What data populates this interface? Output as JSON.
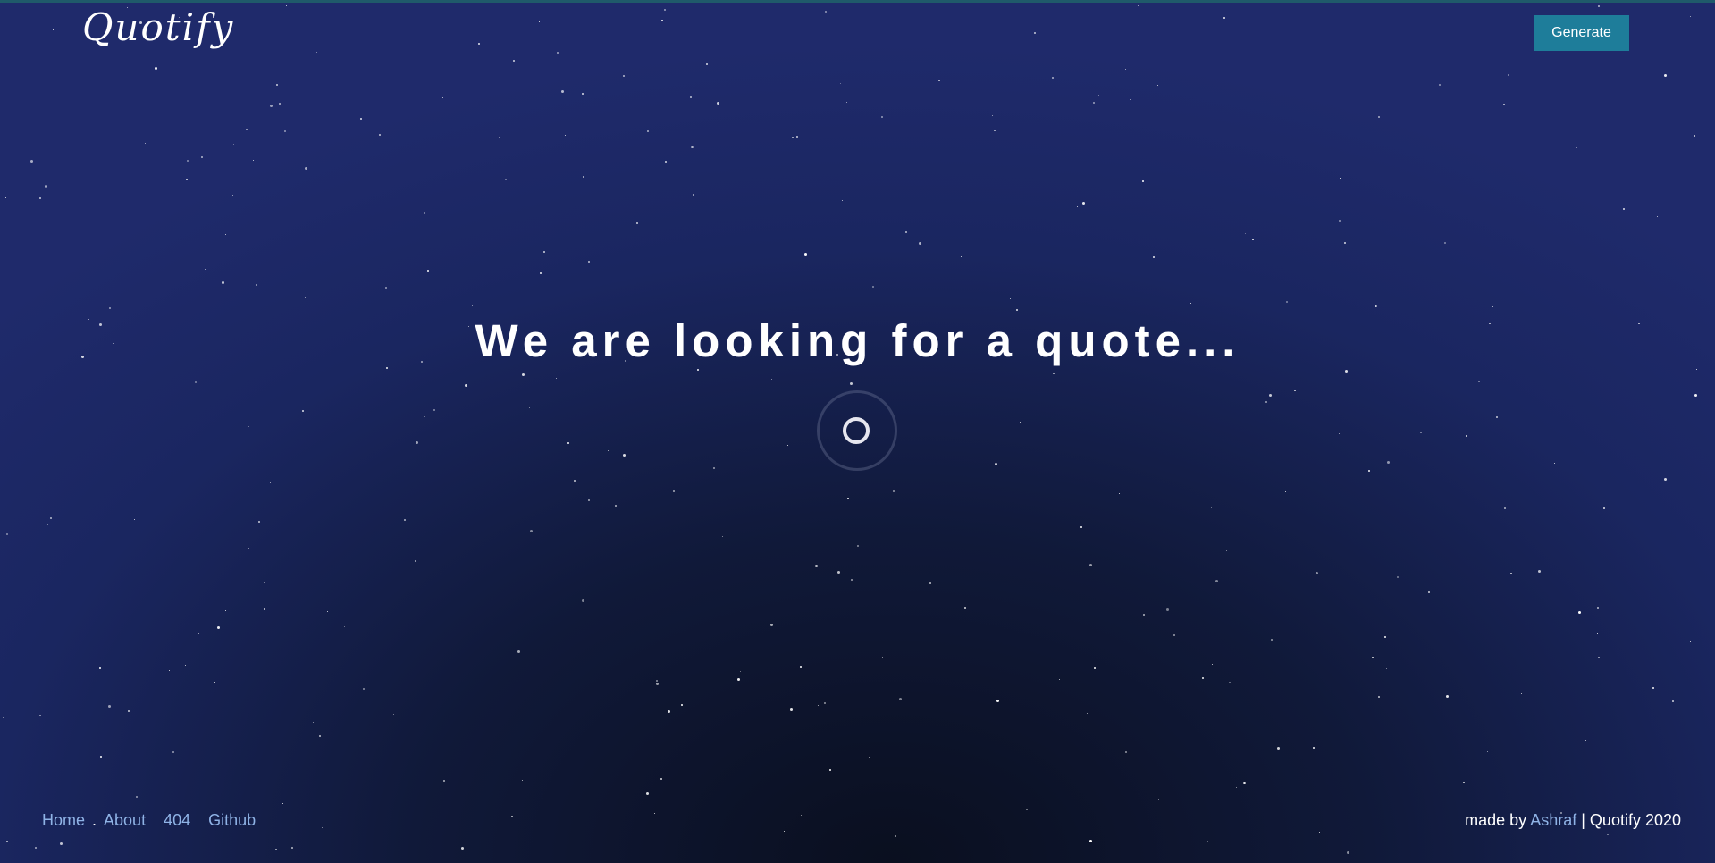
{
  "app": {
    "logo_text": "Quotify"
  },
  "header": {
    "generate_label": "Generate"
  },
  "main": {
    "headline": "We are looking for a quote...",
    "loading_indicator": "spinner"
  },
  "footer": {
    "nav_links": [
      "Home",
      "About",
      "404",
      "Github"
    ],
    "separator": ".",
    "credit_prefix": "made by",
    "author": "Ashraf",
    "credit_suffix": "| Quotify 2020"
  },
  "colors": {
    "background_edge": "#1f2a6b",
    "background_center": "#0a0f1f",
    "accent_button": "#1e7d9a",
    "link": "#8fb3e6",
    "text": "#ffffff"
  }
}
